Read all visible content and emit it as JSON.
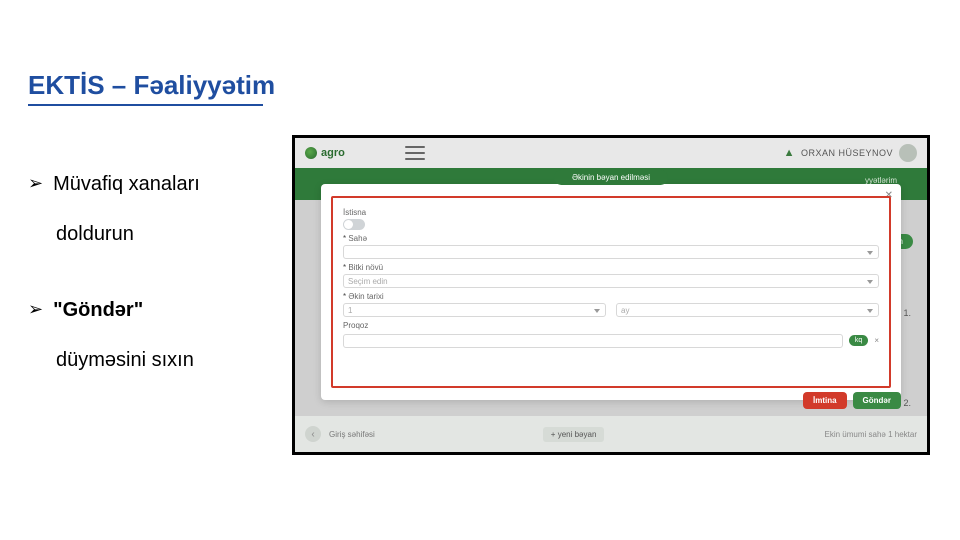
{
  "slide": {
    "title": "EKTİS – Fəaliyyətim",
    "bullets": [
      {
        "lead": "Müvafiq xanaları",
        "rest": "doldurun"
      },
      {
        "lead": "\"Göndər\"",
        "rest": "düyməsini sıxın"
      }
    ]
  },
  "app": {
    "logo": "agro",
    "user_name": "ORXAN HÜSEYNOV",
    "banner_right": "yyətlərim",
    "back_pill": "+əktin",
    "small_list_1": "1.",
    "small_list_2": "2.",
    "foot_home": "Giriş səhifəsi",
    "foot_new": "+ yeni bəyan",
    "foot_hectar": "Ekin ümumi sahə 1 hektar"
  },
  "modal": {
    "pill_title": "Əkinin bəyan edilməsi",
    "close": "✕",
    "istisna_label": "İstisna",
    "sahe_label": "Sahə",
    "bitki_label": "Bitki növü",
    "bitki_placeholder": "Seçim edin",
    "ekin_label": "Əkin tarixi",
    "ekin_val_left": "1",
    "ekin_val_right": "ay",
    "proqoz_label": "Proqoz",
    "unit": "kq",
    "unit_x": "×",
    "actions": {
      "cancel": "İmtina",
      "send": "Göndər"
    }
  }
}
